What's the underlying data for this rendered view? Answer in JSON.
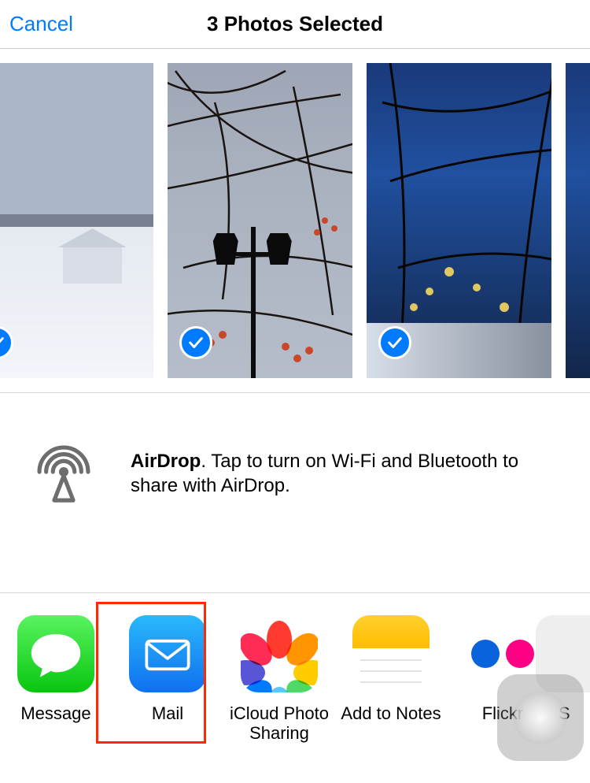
{
  "header": {
    "cancel_label": "Cancel",
    "title": "3 Photos Selected"
  },
  "photos": [
    {
      "selected": true
    },
    {
      "selected": true
    },
    {
      "selected": true
    }
  ],
  "airdrop": {
    "bold": "AirDrop",
    "text": ". Tap to turn on Wi-Fi and Bluetooth to share with AirDrop."
  },
  "apps": [
    {
      "label": "Message"
    },
    {
      "label": "Mail"
    },
    {
      "label": "iCloud Photo Sharing"
    },
    {
      "label": "Add to Notes"
    },
    {
      "label": "Flickr"
    }
  ],
  "partial_app_label": "S",
  "colors": {
    "accent": "#007aff",
    "highlight": "#ff2a00"
  }
}
